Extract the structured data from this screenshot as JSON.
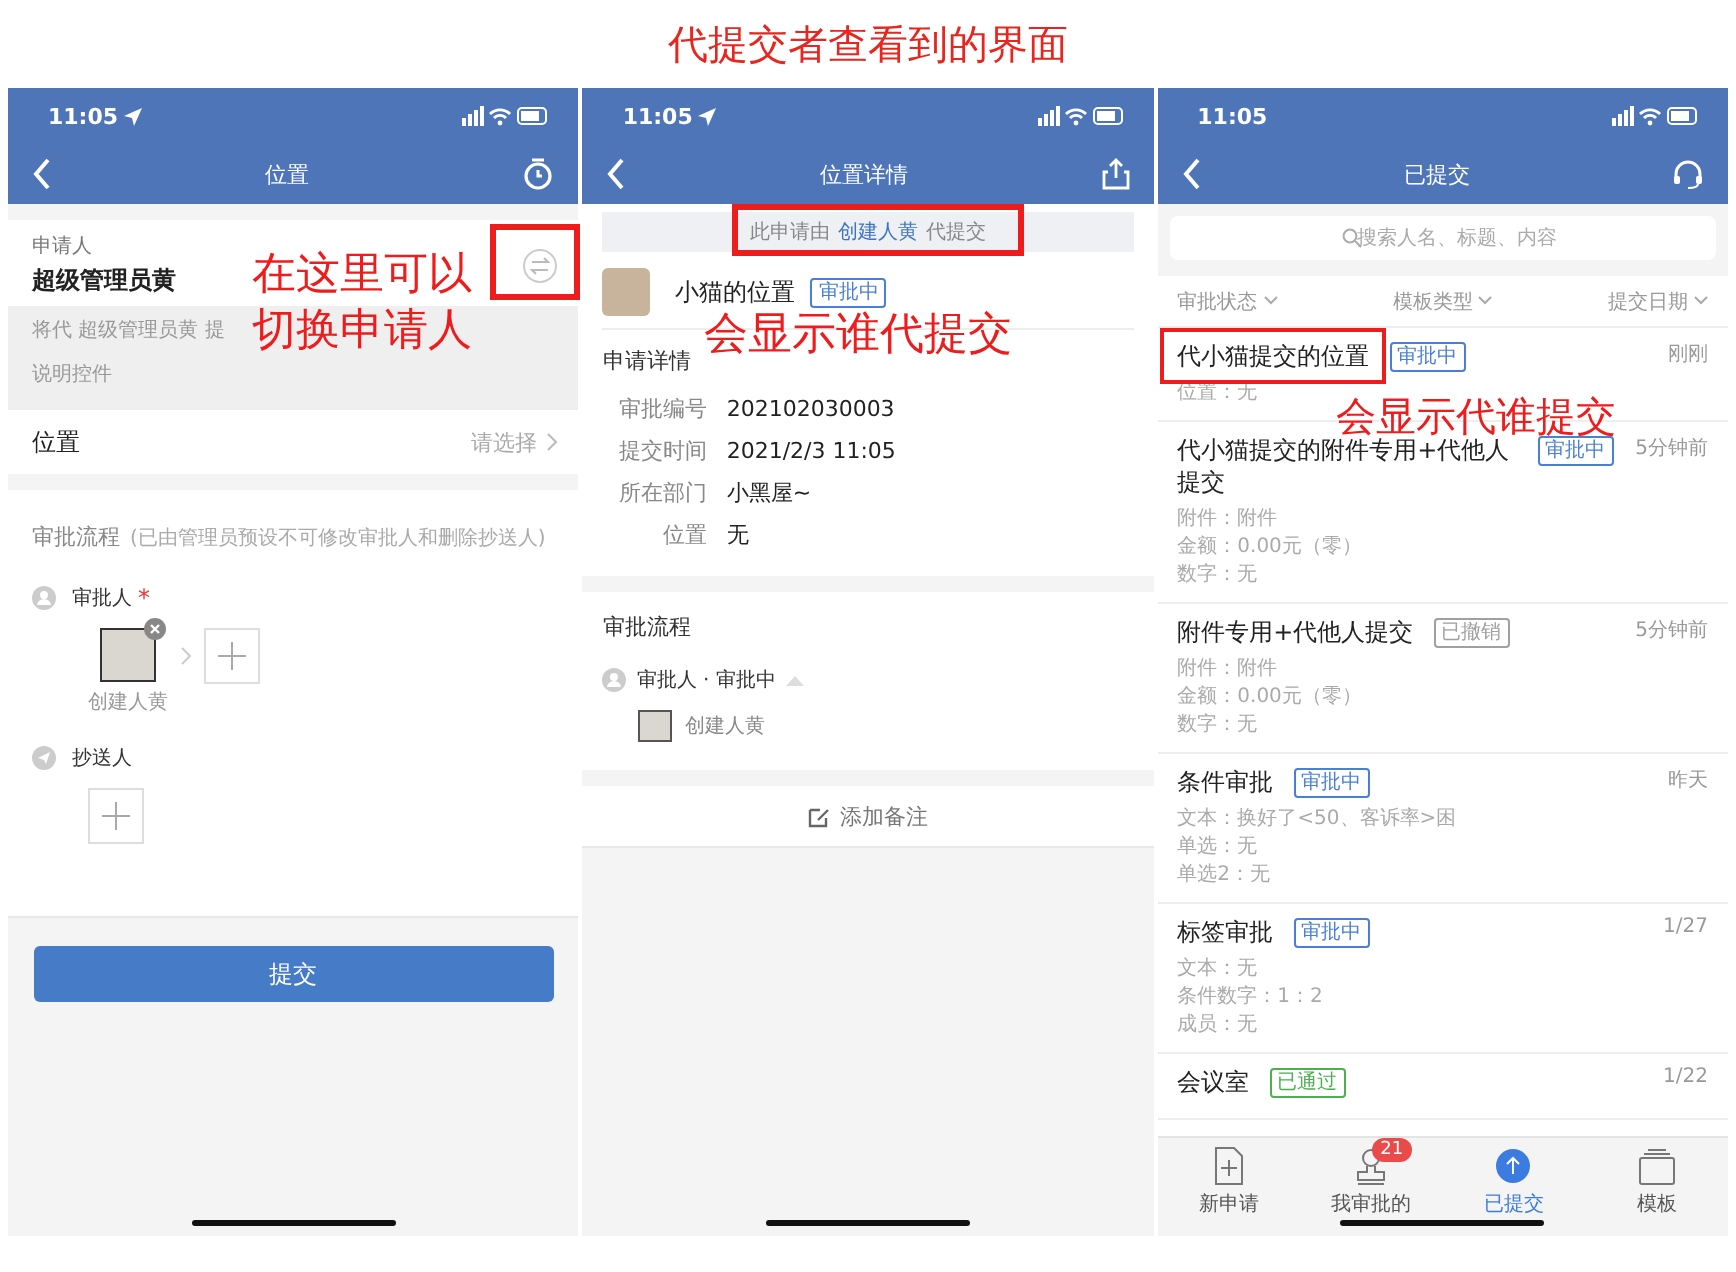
{
  "heading": "代提交者查看到的界面",
  "form_screen": {
    "time": "11:05",
    "title": "位置",
    "applicant_label": "申请人",
    "applicant_name": "超级管理员黄",
    "on_behalf_note": "将代 超级管理员黄 提",
    "description": "说明控件",
    "location_label": "位置",
    "location_value": "请选择",
    "flow_title": "审批流程",
    "flow_note": "(已由管理员预设不可修改审批人和删除抄送人)",
    "approver_label": "审批人",
    "required_mark": "*",
    "approver_name": "创建人黄",
    "cc_label": "抄送人",
    "submit": "提交"
  },
  "detail_screen": {
    "time": "11:05",
    "title": "位置详情",
    "banner_prefix": "此申请由",
    "banner_name": "创建人黄",
    "banner_suffix": "代提交",
    "request_title": "小猫的位置",
    "status": "审批中",
    "section_title": "申请详情",
    "fields": [
      {
        "label": "审批编号",
        "value": "202102030003"
      },
      {
        "label": "提交时间",
        "value": "2021/2/3 11:05"
      },
      {
        "label": "所在部门",
        "value": "小黑屋~"
      },
      {
        "label": "位置",
        "value": "无"
      }
    ],
    "flow_title": "审批流程",
    "flow_step": "审批人 · 审批中",
    "flow_person": "创建人黄",
    "add_note": "添加备注"
  },
  "list_screen": {
    "time": "11:05",
    "title": "已提交",
    "search": {
      "placeholder": "搜索人名、标题、内容"
    },
    "filters": [
      "审批状态",
      "模板类型",
      "提交日期"
    ],
    "items": [
      {
        "title": "代小猫提交的位置",
        "status": "审批中",
        "color": "#4a7fd6",
        "time": "刚刚",
        "lines": [
          "位置：无"
        ]
      },
      {
        "title": "代小猫提交的附件专用+代他人提交",
        "status": "审批中",
        "color": "#4a7fd6",
        "time": "5分钟前",
        "lines": [
          "附件：附件",
          "金额：0.00元（零）",
          "数字：无"
        ]
      },
      {
        "title": "附件专用+代他人提交",
        "status": "已撤销",
        "color": "#a0a0a0",
        "time": "5分钟前",
        "lines": [
          "附件：附件",
          "金额：0.00元（零）",
          "数字：无"
        ]
      },
      {
        "title": "条件审批",
        "status": "审批中",
        "color": "#4a7fd6",
        "time": "昨天",
        "lines": [
          "文本：换好了<50、客诉率>困",
          "单选：无",
          "单选2：无"
        ]
      },
      {
        "title": "标签审批",
        "status": "审批中",
        "color": "#4a7fd6",
        "time": "1/27",
        "lines": [
          "文本：无",
          "条件数字：1：2",
          "成员：无"
        ]
      },
      {
        "title": "会议室",
        "status": "已通过",
        "color": "#4caf50",
        "time": "1/22"
      }
    ],
    "tabs": [
      {
        "kind": "new",
        "label": "新申请",
        "selected": false
      },
      {
        "kind": "approve",
        "label": "我审批的",
        "badge": "21",
        "selected": false
      },
      {
        "kind": "submitted",
        "label": "已提交",
        "selected": true
      },
      {
        "kind": "template",
        "label": "模板",
        "selected": false
      }
    ]
  },
  "annotations": [
    {
      "text": "在这里可以切换申请人"
    },
    {
      "text": "会显示谁代提交"
    },
    {
      "text": "会显示代谁提交"
    }
  ]
}
